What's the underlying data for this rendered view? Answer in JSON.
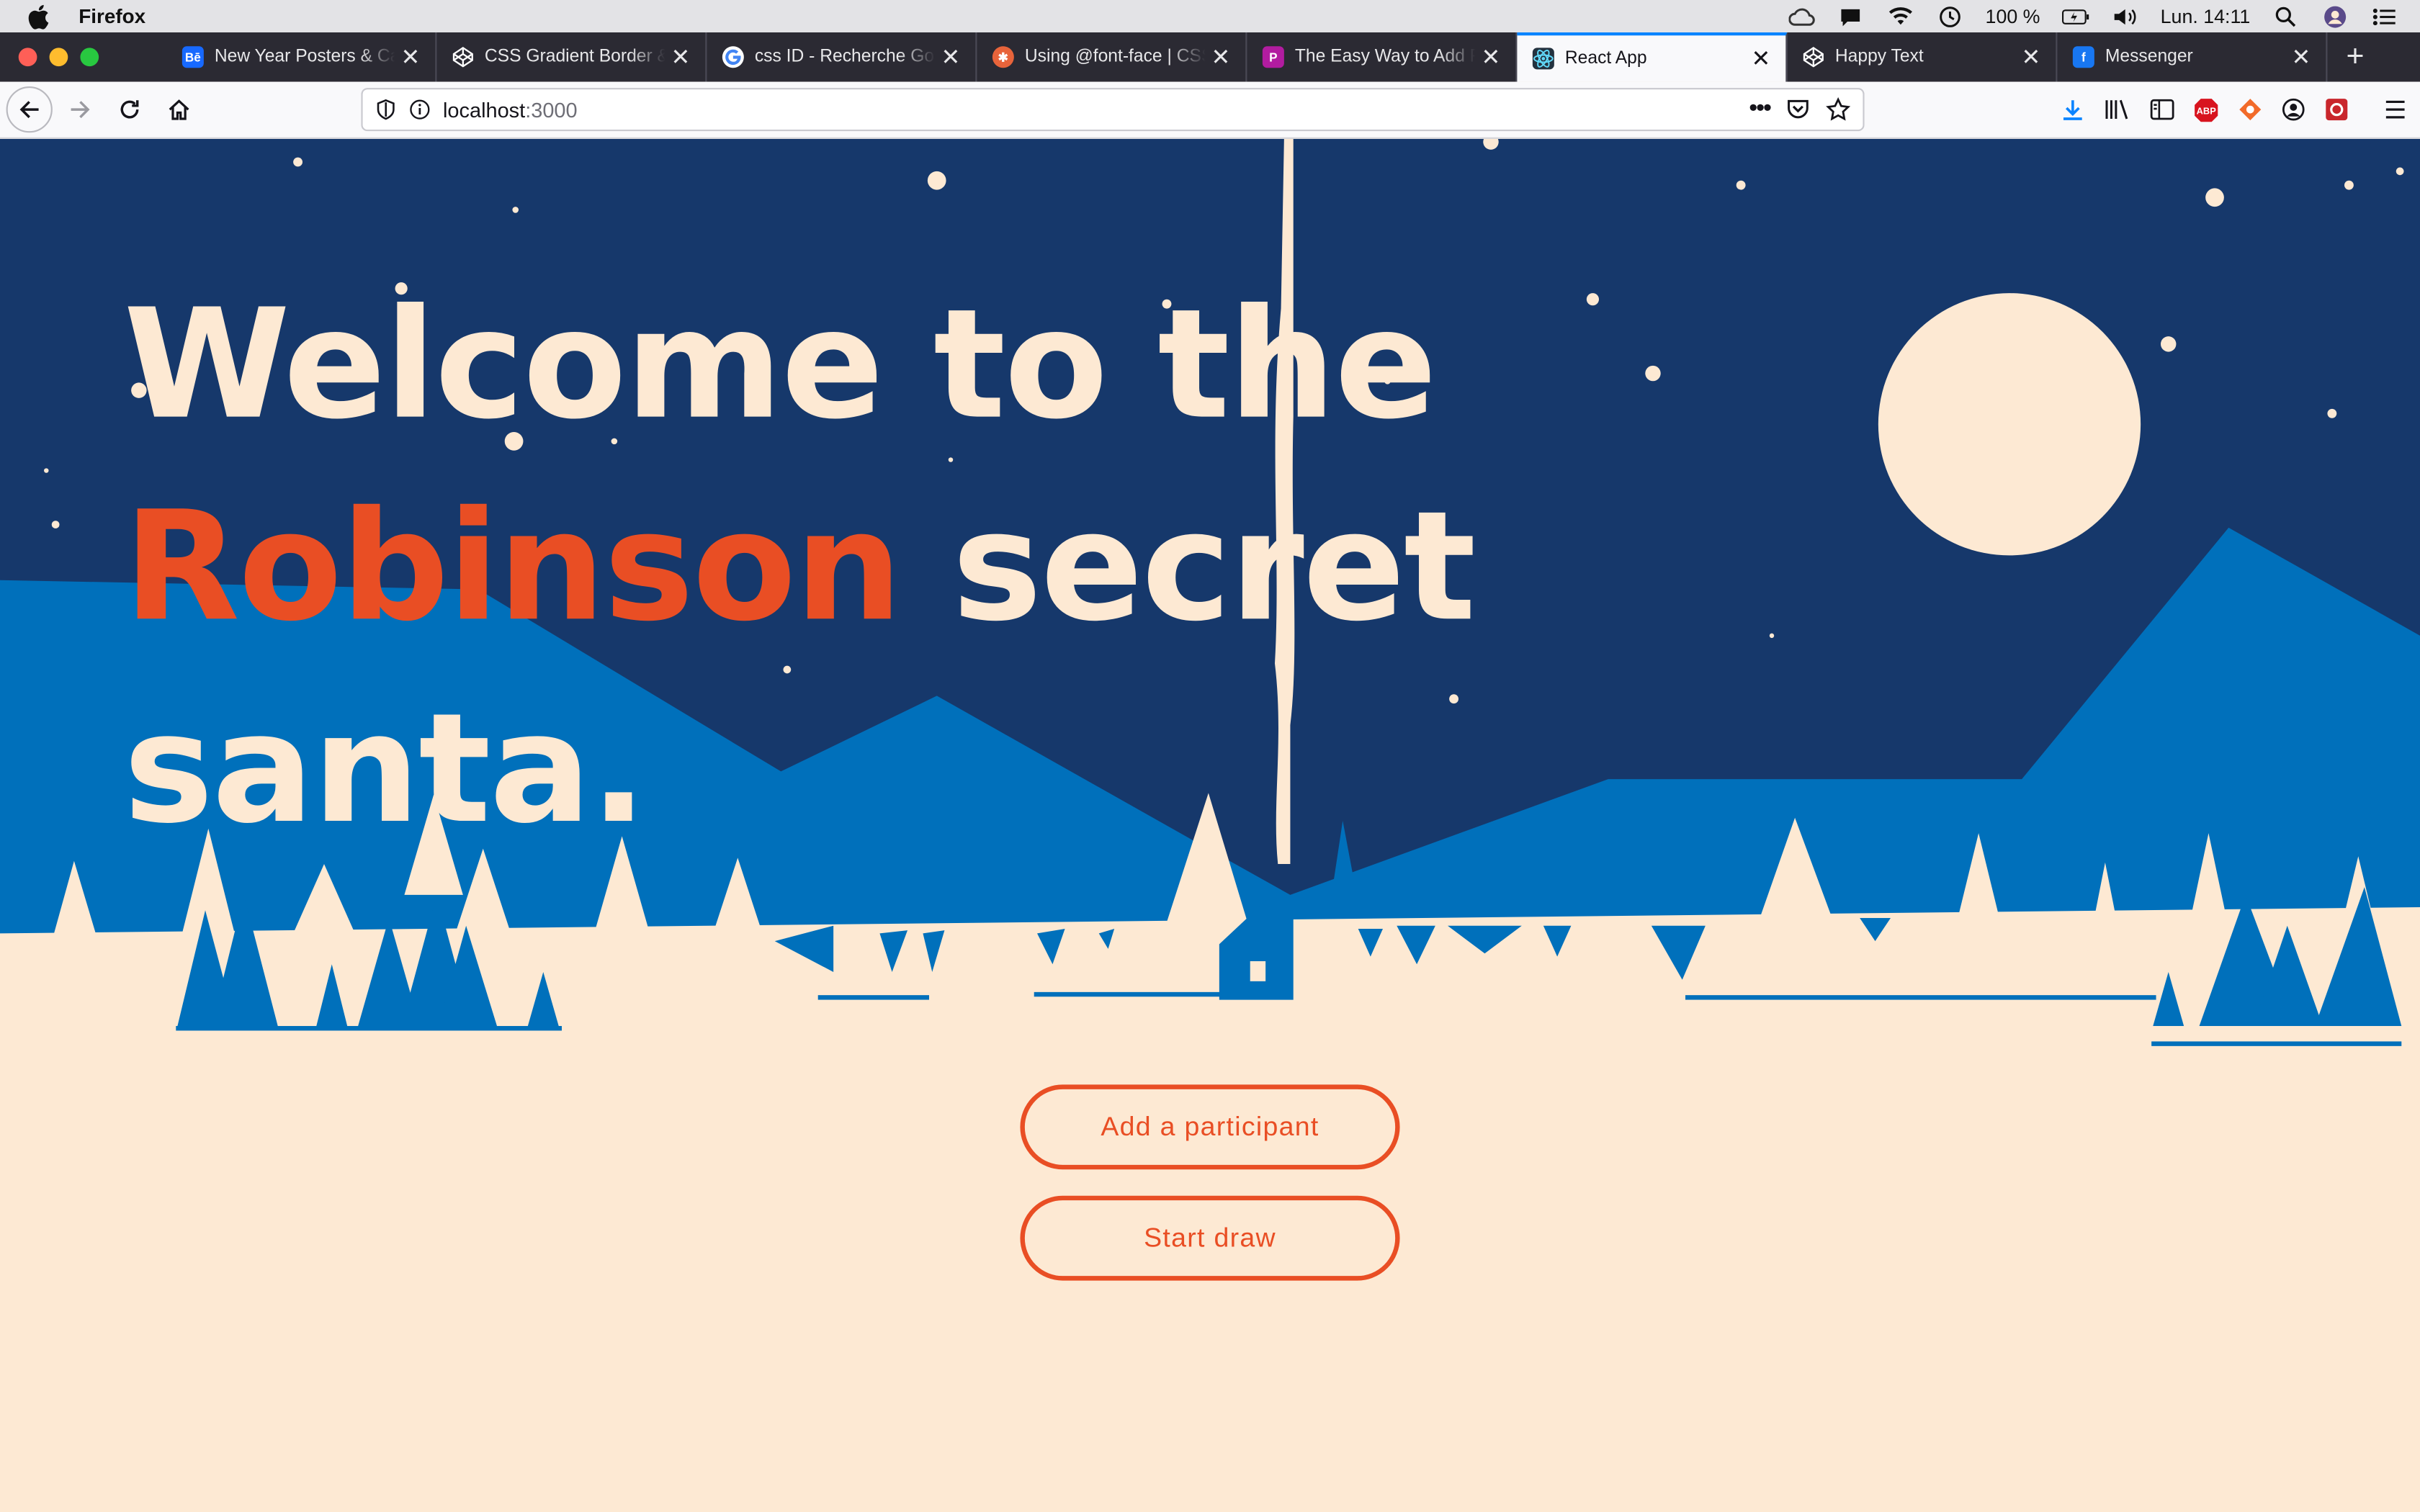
{
  "menubar": {
    "app_name": "Firefox",
    "battery": "100 %",
    "clock": "Lun. 14:11"
  },
  "tabs": [
    {
      "title": "New Year Posters & Car",
      "favicon": "behance-icon",
      "color": "#1769ff",
      "active": false
    },
    {
      "title": "CSS Gradient Border & F",
      "favicon": "codepen-icon",
      "color": "#ffffff",
      "active": false
    },
    {
      "title": "css ID - Recherche Goo",
      "favicon": "google-icon",
      "color": "#ffffff",
      "active": false
    },
    {
      "title": "Using @font-face | CSS",
      "favicon": "css-tricks-icon",
      "color": "#e8643b",
      "active": false
    },
    {
      "title": "The Easy Way to Add Fo",
      "favicon": "picmonkey-icon",
      "color": "#b21ca0",
      "active": false
    },
    {
      "title": "React App",
      "favicon": "react-icon",
      "color": "#1e5cc0",
      "active": true
    },
    {
      "title": "Happy Text",
      "favicon": "codepen-icon",
      "color": "#ffffff",
      "active": false
    },
    {
      "title": "Messenger",
      "favicon": "facebook-icon",
      "color": "#1877f2",
      "active": false
    }
  ],
  "navbar": {
    "url_host": "localhost",
    "url_path": ":3000"
  },
  "page": {
    "headline_line1": "Welcome to the",
    "headline_accent": "Robinson",
    "headline_rest": " secret",
    "headline_line3": "santa.",
    "add_participant_label": "Add a participant",
    "start_draw_label": "Start draw"
  },
  "colors": {
    "sky": "#16386b",
    "mountain": "#0070bb",
    "cream": "#fde9d3",
    "accent": "#e94e24"
  }
}
